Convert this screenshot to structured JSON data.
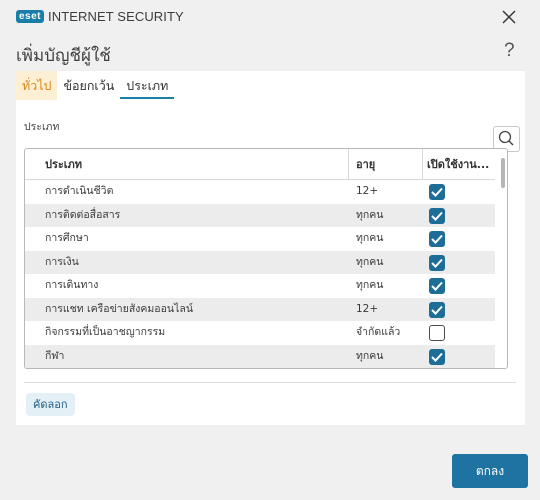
{
  "app": {
    "logo_text": "eset",
    "product_name": "INTERNET SECURITY"
  },
  "header": {
    "title": "เพิ่มบัญชีผู้ใช้",
    "help": "?"
  },
  "tabs": [
    {
      "label": "ทั่วไป",
      "state": "highlighted"
    },
    {
      "label": "ข้อยกเว้น",
      "state": "normal"
    },
    {
      "label": "ประเภท",
      "state": "active"
    }
  ],
  "section": {
    "label": "ประเภท"
  },
  "table": {
    "columns": [
      "ประเภท",
      "อายุ",
      "เปิดใช้งาน..."
    ],
    "rows": [
      {
        "category": "การดำเนินชีวิต",
        "age": "12+",
        "enabled": true
      },
      {
        "category": "การติดต่อสื่อสาร",
        "age": "ทุกคน",
        "enabled": true
      },
      {
        "category": "การศึกษา",
        "age": "ทุกคน",
        "enabled": true
      },
      {
        "category": "การเงิน",
        "age": "ทุกคน",
        "enabled": true
      },
      {
        "category": "การเดินทาง",
        "age": "ทุกคน",
        "enabled": true
      },
      {
        "category": "การแชท เครือข่ายสังคมออนไลน์",
        "age": "12+",
        "enabled": true
      },
      {
        "category": "กิจกรรมที่เป็นอาชญากรรม",
        "age": "จำกัดแล้ว",
        "enabled": false
      },
      {
        "category": "กีฬา",
        "age": "ทุกคน",
        "enabled": true
      }
    ]
  },
  "footer": {
    "copy_label": "คัดลอก",
    "ok_label": "ตกลง"
  },
  "colors": {
    "accent": "#1f73a3",
    "tab_highlight_bg": "#fdefd4",
    "tab_highlight_text": "#d58a1b",
    "checkbox_on": "#1e6d96"
  }
}
